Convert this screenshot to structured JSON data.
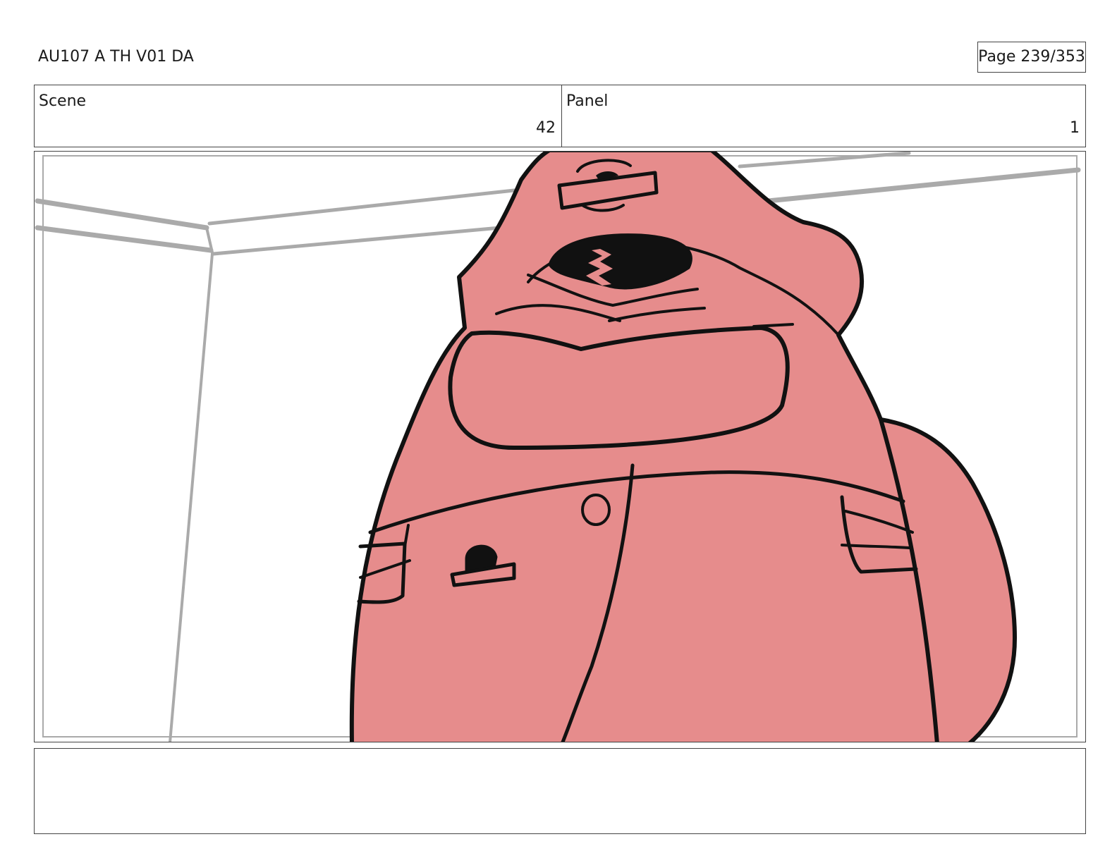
{
  "header": {
    "document_id": "AU107 A TH V01 DA",
    "page_label": "Page 239/353"
  },
  "info": {
    "scene_label": "Scene",
    "scene_value": "42",
    "panel_label": "Panel",
    "panel_value": "1"
  },
  "colors": {
    "character_fill": "#e68c8c",
    "line": "#111111",
    "room_line": "#aaaaaa"
  },
  "notes": {
    "text": ""
  }
}
